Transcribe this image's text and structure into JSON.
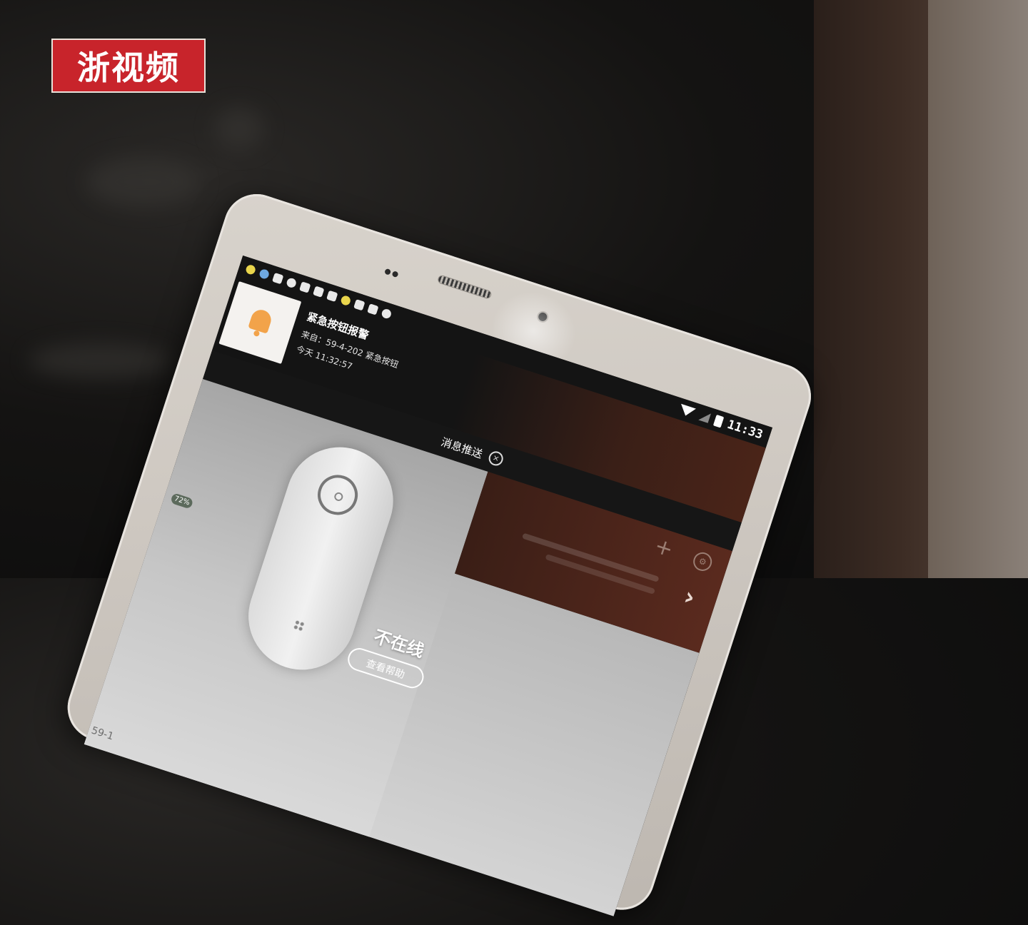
{
  "logo": {
    "text": "浙视频"
  },
  "statusbar": {
    "time": "11:33"
  },
  "notification": {
    "title": "紧急按钮报警",
    "from": "来自：59-4-202 紧急按钮",
    "time": "今天 11:32:57"
  },
  "message_bar": {
    "label": "消息推送"
  },
  "device": {
    "status": "不在线",
    "help_button": "查看帮助",
    "battery_badge": "72%",
    "row_label": "59-1"
  },
  "colors": {
    "logo_red": "#c8242b",
    "notification_accent": "#4a2418",
    "bell_orange": "#f2a34a"
  }
}
